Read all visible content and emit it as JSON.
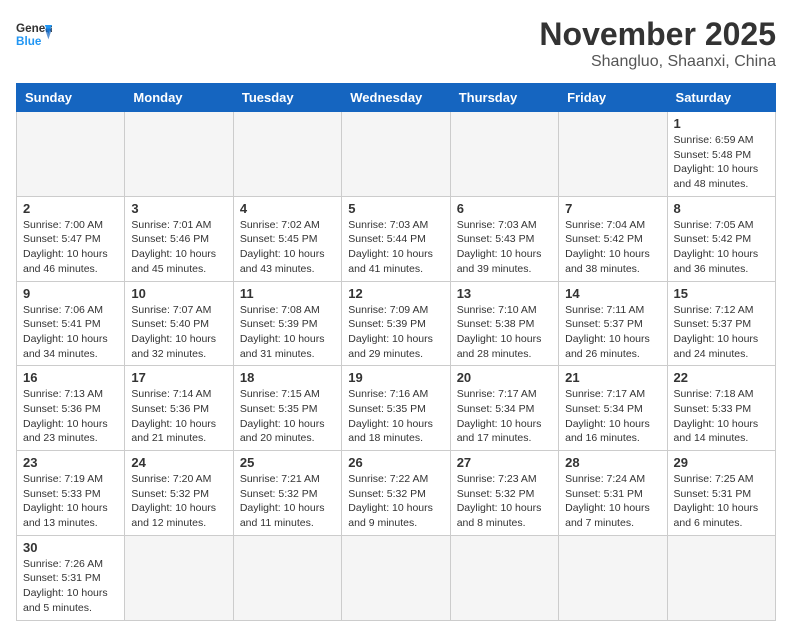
{
  "header": {
    "logo_general": "General",
    "logo_blue": "Blue",
    "month_title": "November 2025",
    "location": "Shangluo, Shaanxi, China"
  },
  "weekdays": [
    "Sunday",
    "Monday",
    "Tuesday",
    "Wednesday",
    "Thursday",
    "Friday",
    "Saturday"
  ],
  "days": [
    {
      "date": "",
      "info": ""
    },
    {
      "date": "",
      "info": ""
    },
    {
      "date": "",
      "info": ""
    },
    {
      "date": "",
      "info": ""
    },
    {
      "date": "",
      "info": ""
    },
    {
      "date": "",
      "info": ""
    },
    {
      "date": "1",
      "info": "Sunrise: 6:59 AM\nSunset: 5:48 PM\nDaylight: 10 hours and 48 minutes."
    },
    {
      "date": "2",
      "info": "Sunrise: 7:00 AM\nSunset: 5:47 PM\nDaylight: 10 hours and 46 minutes."
    },
    {
      "date": "3",
      "info": "Sunrise: 7:01 AM\nSunset: 5:46 PM\nDaylight: 10 hours and 45 minutes."
    },
    {
      "date": "4",
      "info": "Sunrise: 7:02 AM\nSunset: 5:45 PM\nDaylight: 10 hours and 43 minutes."
    },
    {
      "date": "5",
      "info": "Sunrise: 7:03 AM\nSunset: 5:44 PM\nDaylight: 10 hours and 41 minutes."
    },
    {
      "date": "6",
      "info": "Sunrise: 7:03 AM\nSunset: 5:43 PM\nDaylight: 10 hours and 39 minutes."
    },
    {
      "date": "7",
      "info": "Sunrise: 7:04 AM\nSunset: 5:42 PM\nDaylight: 10 hours and 38 minutes."
    },
    {
      "date": "8",
      "info": "Sunrise: 7:05 AM\nSunset: 5:42 PM\nDaylight: 10 hours and 36 minutes."
    },
    {
      "date": "9",
      "info": "Sunrise: 7:06 AM\nSunset: 5:41 PM\nDaylight: 10 hours and 34 minutes."
    },
    {
      "date": "10",
      "info": "Sunrise: 7:07 AM\nSunset: 5:40 PM\nDaylight: 10 hours and 32 minutes."
    },
    {
      "date": "11",
      "info": "Sunrise: 7:08 AM\nSunset: 5:39 PM\nDaylight: 10 hours and 31 minutes."
    },
    {
      "date": "12",
      "info": "Sunrise: 7:09 AM\nSunset: 5:39 PM\nDaylight: 10 hours and 29 minutes."
    },
    {
      "date": "13",
      "info": "Sunrise: 7:10 AM\nSunset: 5:38 PM\nDaylight: 10 hours and 28 minutes."
    },
    {
      "date": "14",
      "info": "Sunrise: 7:11 AM\nSunset: 5:37 PM\nDaylight: 10 hours and 26 minutes."
    },
    {
      "date": "15",
      "info": "Sunrise: 7:12 AM\nSunset: 5:37 PM\nDaylight: 10 hours and 24 minutes."
    },
    {
      "date": "16",
      "info": "Sunrise: 7:13 AM\nSunset: 5:36 PM\nDaylight: 10 hours and 23 minutes."
    },
    {
      "date": "17",
      "info": "Sunrise: 7:14 AM\nSunset: 5:36 PM\nDaylight: 10 hours and 21 minutes."
    },
    {
      "date": "18",
      "info": "Sunrise: 7:15 AM\nSunset: 5:35 PM\nDaylight: 10 hours and 20 minutes."
    },
    {
      "date": "19",
      "info": "Sunrise: 7:16 AM\nSunset: 5:35 PM\nDaylight: 10 hours and 18 minutes."
    },
    {
      "date": "20",
      "info": "Sunrise: 7:17 AM\nSunset: 5:34 PM\nDaylight: 10 hours and 17 minutes."
    },
    {
      "date": "21",
      "info": "Sunrise: 7:17 AM\nSunset: 5:34 PM\nDaylight: 10 hours and 16 minutes."
    },
    {
      "date": "22",
      "info": "Sunrise: 7:18 AM\nSunset: 5:33 PM\nDaylight: 10 hours and 14 minutes."
    },
    {
      "date": "23",
      "info": "Sunrise: 7:19 AM\nSunset: 5:33 PM\nDaylight: 10 hours and 13 minutes."
    },
    {
      "date": "24",
      "info": "Sunrise: 7:20 AM\nSunset: 5:32 PM\nDaylight: 10 hours and 12 minutes."
    },
    {
      "date": "25",
      "info": "Sunrise: 7:21 AM\nSunset: 5:32 PM\nDaylight: 10 hours and 11 minutes."
    },
    {
      "date": "26",
      "info": "Sunrise: 7:22 AM\nSunset: 5:32 PM\nDaylight: 10 hours and 9 minutes."
    },
    {
      "date": "27",
      "info": "Sunrise: 7:23 AM\nSunset: 5:32 PM\nDaylight: 10 hours and 8 minutes."
    },
    {
      "date": "28",
      "info": "Sunrise: 7:24 AM\nSunset: 5:31 PM\nDaylight: 10 hours and 7 minutes."
    },
    {
      "date": "29",
      "info": "Sunrise: 7:25 AM\nSunset: 5:31 PM\nDaylight: 10 hours and 6 minutes."
    },
    {
      "date": "30",
      "info": "Sunrise: 7:26 AM\nSunset: 5:31 PM\nDaylight: 10 hours and 5 minutes."
    },
    {
      "date": "",
      "info": ""
    },
    {
      "date": "",
      "info": ""
    },
    {
      "date": "",
      "info": ""
    },
    {
      "date": "",
      "info": ""
    },
    {
      "date": "",
      "info": ""
    },
    {
      "date": "",
      "info": ""
    }
  ]
}
